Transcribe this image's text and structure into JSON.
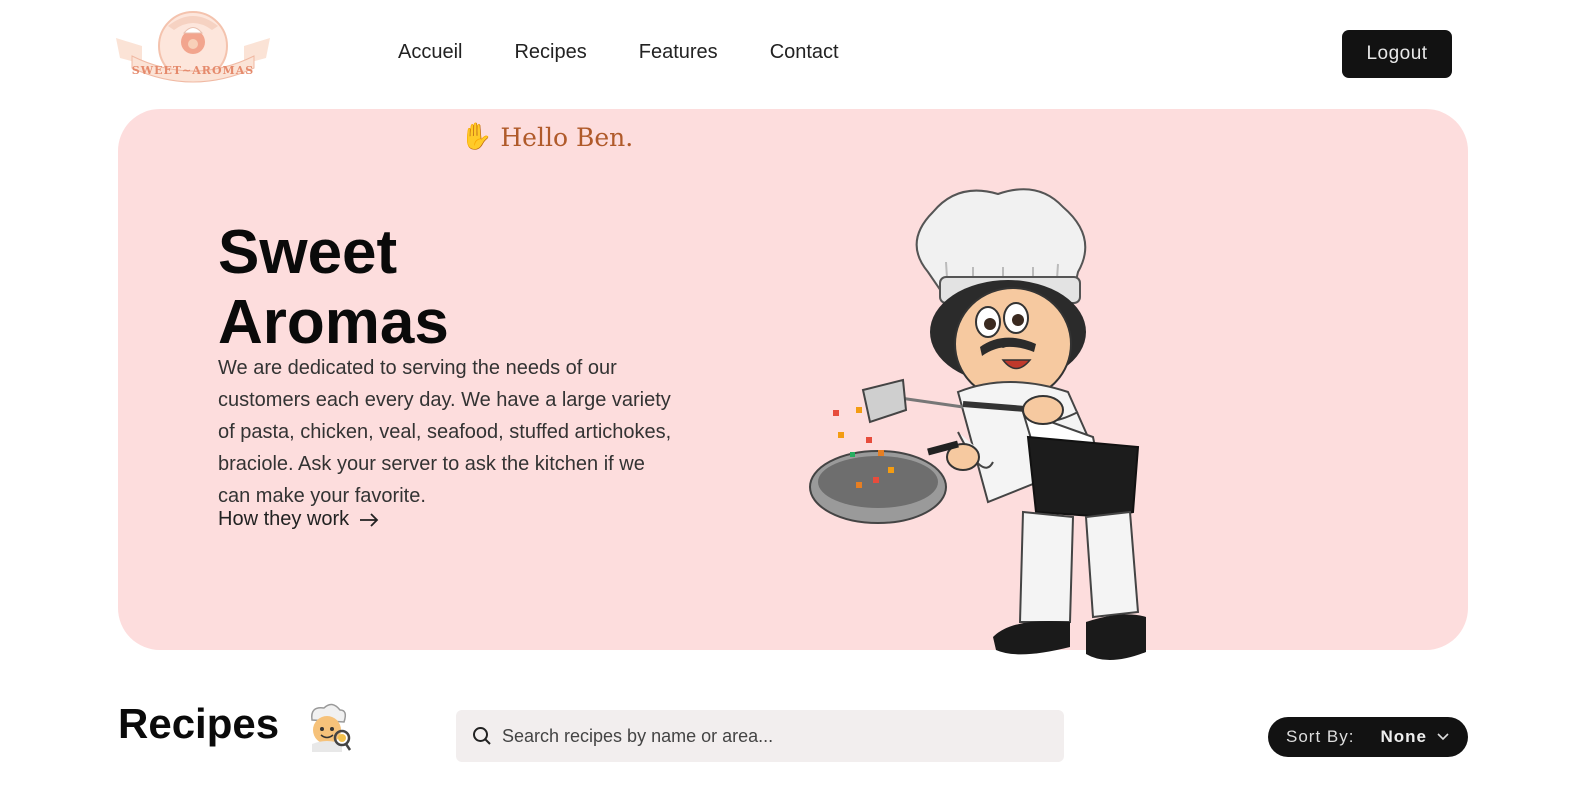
{
  "header": {
    "logo_text": "SWEET~AROMAS",
    "nav": [
      {
        "label": "Accueil"
      },
      {
        "label": "Recipes"
      },
      {
        "label": "Features"
      },
      {
        "label": "Contact"
      }
    ],
    "logout_label": "Logout"
  },
  "hero": {
    "greeting": "Hello Ben.",
    "title_line1": "Sweet",
    "title_line2": "Aromas",
    "description": "We are dedicated to serving the needs of our customers each every day. We have a large variety of pasta, chicken, veal, seafood, stuffed artichokes, braciole. Ask your server to ask the kitchen if we can make your favorite.",
    "cta_label": "How they work",
    "background_color": "#fddddd"
  },
  "recipes": {
    "title": "Recipes",
    "search_placeholder": "Search recipes by name or area...",
    "sort_label": "Sort By:",
    "sort_value": "None"
  },
  "icons": {
    "wave": "waving-hand-icon",
    "arrow": "arrow-right-icon",
    "search": "search-icon",
    "chevron": "chevron-down-icon",
    "chef": "chef-emoji-icon"
  }
}
